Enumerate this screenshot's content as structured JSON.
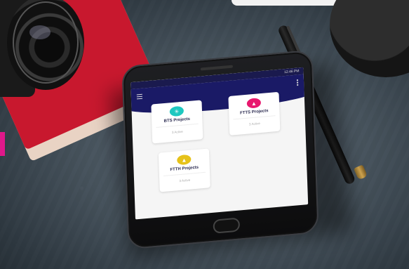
{
  "app": {
    "status_time": "12:46 PM",
    "cards": [
      {
        "title": "BTS Projects",
        "sub": "3 Active",
        "color": "#1ec8c0",
        "icon": "tower-icon"
      },
      {
        "title": "FTTS Projects",
        "sub": "3 Active",
        "color": "#e8186e",
        "icon": "network-icon"
      },
      {
        "title": "FTTH Projects",
        "sub": "3 Active",
        "color": "#e6c21a",
        "icon": "home-network-icon"
      }
    ]
  }
}
